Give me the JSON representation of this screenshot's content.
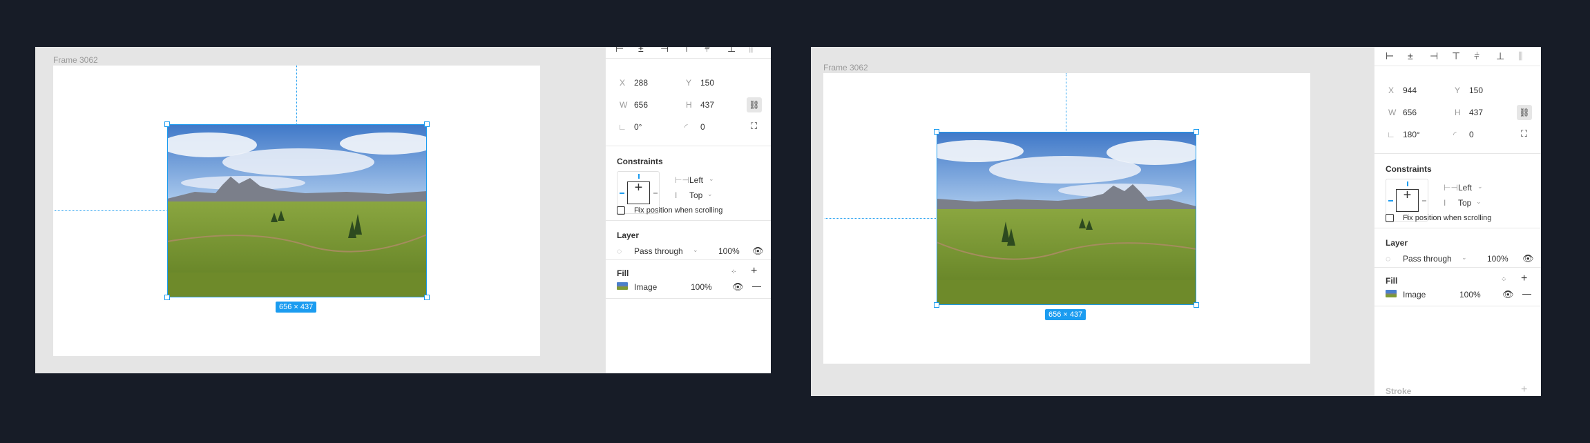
{
  "views": [
    {
      "frame_label": "Frame 3062",
      "size_badge": "656 × 437",
      "x": "288",
      "y": "150",
      "w": "656",
      "h": "437",
      "rotation": "0°",
      "radius": "0",
      "constraints_title": "Constraints",
      "constraint_h": "Left",
      "constraint_v": "Top",
      "fix_position": "Fix position when scrolling",
      "layer_title": "Layer",
      "blend_mode": "Pass through",
      "layer_opacity": "100%",
      "fill_title": "Fill",
      "fill_type": "Image",
      "fill_opacity": "100%",
      "image_mirrored": false
    },
    {
      "frame_label": "Frame 3062",
      "size_badge": "656 × 437",
      "x": "944",
      "y": "150",
      "w": "656",
      "h": "437",
      "rotation": "180°",
      "radius": "0",
      "constraints_title": "Constraints",
      "constraint_h": "Left",
      "constraint_v": "Top",
      "fix_position": "Fix position when scrolling",
      "layer_title": "Layer",
      "blend_mode": "Pass through",
      "layer_opacity": "100%",
      "fill_title": "Fill",
      "fill_type": "Image",
      "fill_opacity": "100%",
      "stroke_title": "Stroke",
      "image_mirrored": true
    }
  ],
  "labels": {
    "x": "X",
    "y": "Y",
    "w": "W",
    "h": "H"
  },
  "colors": {
    "selection": "#1b9cf0",
    "background": "#171c27",
    "canvas": "#e5e5e5"
  },
  "icons": [
    "align-left-icon",
    "align-center-h-icon",
    "align-right-icon",
    "align-top-icon",
    "align-middle-icon",
    "align-bottom-icon",
    "distribute-icon",
    "constrain-proportions-icon",
    "rotation-icon",
    "corner-radius-icon",
    "independent-corners-icon",
    "eye-icon",
    "plus-icon",
    "minus-icon",
    "styles-grid-icon",
    "blend-icon"
  ]
}
